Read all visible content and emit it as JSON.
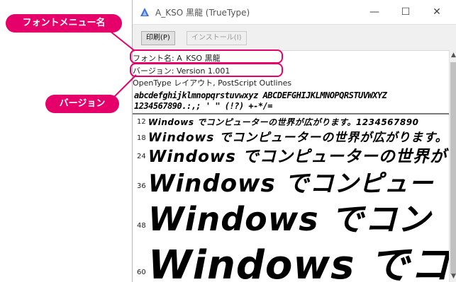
{
  "window": {
    "title": "A_KSO 黒龍 (TrueType)",
    "minimize_glyph": "—",
    "maximize_glyph": "☐",
    "close_glyph": "✕"
  },
  "toolbar": {
    "print_label": "印刷(P)",
    "install_label": "インストール(I)"
  },
  "font_info": {
    "name": "フォント名: A_KSO 黒龍",
    "version": "バージョン: Version 1.001",
    "type": "OpenType レイアウト, PostScript Outlines"
  },
  "charset": {
    "line1": "abcdefghijklmnopqrstuvwxyz ABCDEFGHIJKLMNOPQRSTUVWXYZ",
    "line2": "1234567890.:,;  ' \" (!?) +-*/="
  },
  "samples": [
    {
      "size": "12",
      "text": "Windows でコンピューターの世界が広がります。1234567890"
    },
    {
      "size": "18",
      "text": "Windows でコンピューターの世界が広がります。"
    },
    {
      "size": "24",
      "text": "Windows でコンピューターの世界が"
    },
    {
      "size": "36",
      "text": "Windows でコンピュー"
    },
    {
      "size": "48",
      "text": "Windows でコン"
    },
    {
      "size": "60",
      "text": "Windows でコ"
    }
  ],
  "callouts": {
    "font_name": "フォントメニュー名",
    "version": "バージョン"
  },
  "scrollbar": {
    "up_glyph": "▲",
    "down_glyph": "▼"
  },
  "colors": {
    "accent": "#e5006a"
  }
}
